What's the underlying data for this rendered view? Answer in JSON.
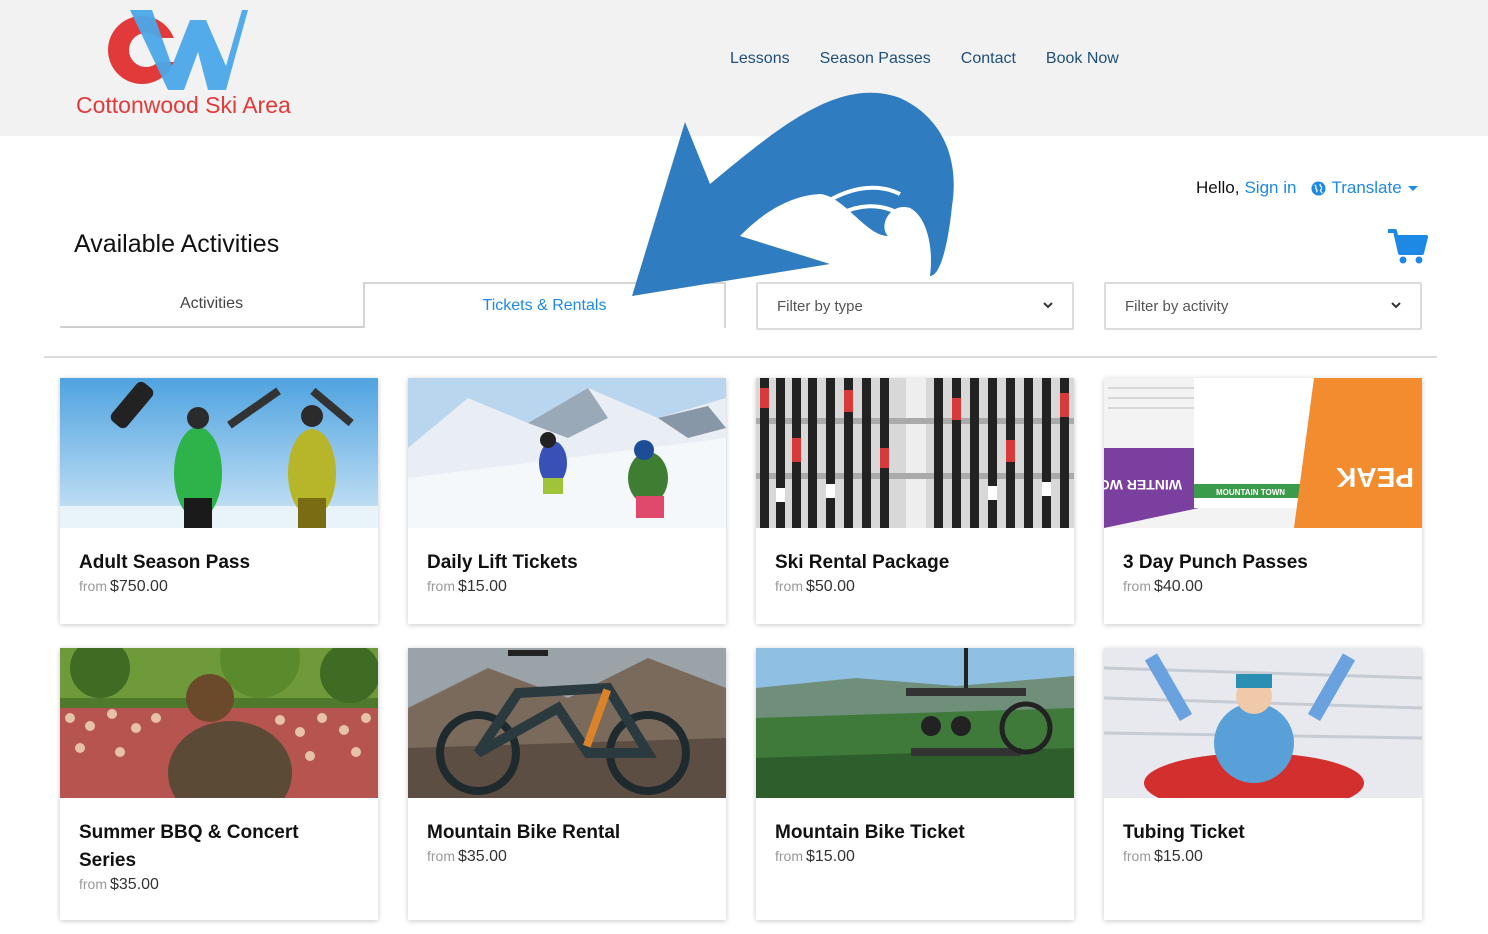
{
  "brand": {
    "name": "Cottonwood Ski Area",
    "logo_letters": "CW"
  },
  "nav": [
    "Lessons",
    "Season Passes",
    "Contact",
    "Book Now"
  ],
  "user": {
    "greeting": "Hello,",
    "sign_in": "Sign in",
    "translate": "Translate"
  },
  "page_title": "Available Activities",
  "tabs": {
    "activities": "Activities",
    "tickets_rentals": "Tickets & Rentals",
    "active": "Tickets & Rentals"
  },
  "filters": {
    "type": "Filter by type",
    "activity": "Filter by activity"
  },
  "price_prefix": "from",
  "products": [
    {
      "name": "Adult Season Pass",
      "price": "$750.00"
    },
    {
      "name": "Daily Lift Tickets",
      "price": "$15.00"
    },
    {
      "name": "Ski Rental Package",
      "price": "$50.00"
    },
    {
      "name": "3 Day Punch Passes",
      "price": "$40.00"
    },
    {
      "name": "Summer BBQ & Concert Series",
      "price": "$35.00"
    },
    {
      "name": "Mountain Bike Rental",
      "price": "$35.00"
    },
    {
      "name": "Mountain Bike Ticket",
      "price": "$15.00"
    },
    {
      "name": "Tubing Ticket",
      "price": "$15.00"
    }
  ],
  "punch_pass_text": {
    "mountain_town": "MOUNTAIN TOWN",
    "winter_works": "WINTER WORKS",
    "peak": "PEAK"
  },
  "colors": {
    "accent": "#1e88e5",
    "nav_text": "#1d4f7a",
    "logo_red": "#e23a3a",
    "logo_blue": "#4aa8e8",
    "arrow_blue": "#2f7cc0"
  }
}
